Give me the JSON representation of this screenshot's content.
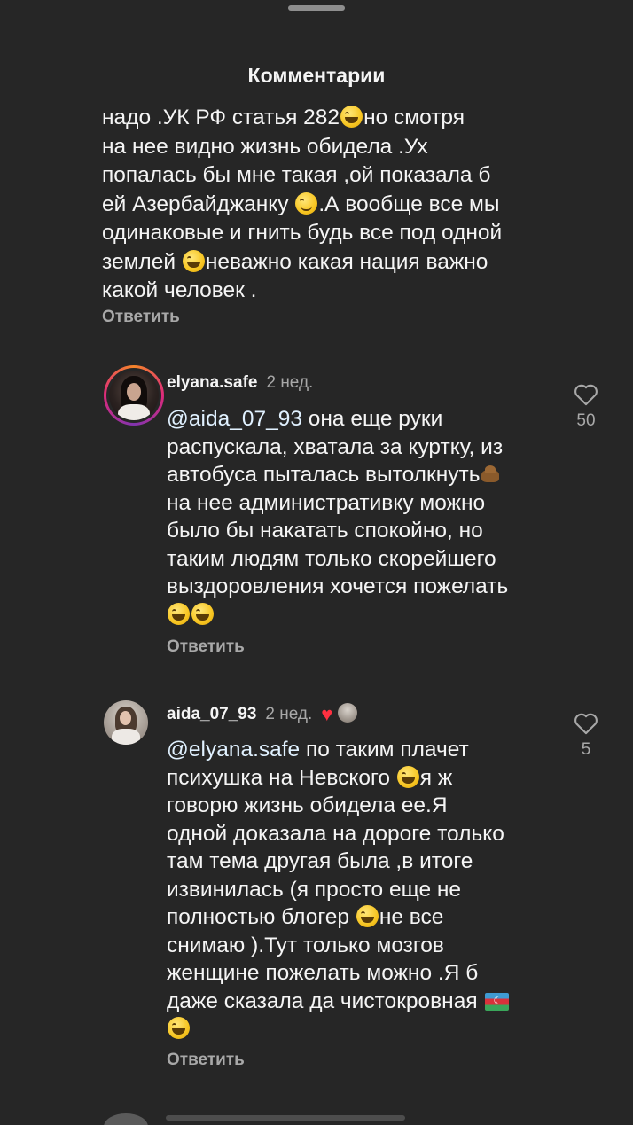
{
  "header": {
    "title": "Комментарии"
  },
  "comment0": {
    "lines": [
      "надо .УК РФ статья 282",
      "но смотря",
      "на нее видно жизнь обидела .Ух",
      "попалась бы мне такая ,ой показала б",
      "ей Азербайджанку ",
      ".А вообще все мы",
      "одинаковые и гнить будь все под одной",
      "землей ",
      "неважно какая нация важно",
      "какой человек ."
    ],
    "reply": "Ответить"
  },
  "comment1": {
    "username": "elyana.safe",
    "time": "2 нед.",
    "mention": "@aida_07_93",
    "lines": [
      " она еще руки",
      "распускала, хватала за куртку, из",
      "автобуса пыталась вытолкнуть",
      "на нее административку можно",
      "было бы накатать спокойно, но",
      "таким людям только скорейшего",
      "выздоровления хочется пожелать"
    ],
    "reply": "Ответить",
    "likes": "50"
  },
  "comment2": {
    "username": "aida_07_93",
    "time": "2 нед.",
    "mention": "@elyana.safe",
    "lines": [
      " по таким плачет",
      "психушка на Невского ",
      "я ж",
      "говорю жизнь обидела ее.Я",
      "одной доказала на дороге только",
      "там тема другая была ,в итоге",
      "извинилась (я просто еще не",
      "полностью блогер ",
      "не  все",
      "снимаю ).Тут только мозгов",
      "женщине пожелать можно .Я б",
      "даже сказала да чистокровная "
    ],
    "reply": "Ответить",
    "likes": "5"
  },
  "icons": {
    "like": "heart-outline-icon",
    "liked_by_author": "heart-filled-icon",
    "laugh_emoji": "grinning-sweat-emoji",
    "wink_emoji": "wink-emoji",
    "poop_emoji": "poop-emoji",
    "flag": "azerbaijan-flag-emoji"
  },
  "colors": {
    "background": "#262626",
    "text": "#f5f5f5",
    "muted": "#a8a8a8",
    "heart": "#ff3040"
  }
}
